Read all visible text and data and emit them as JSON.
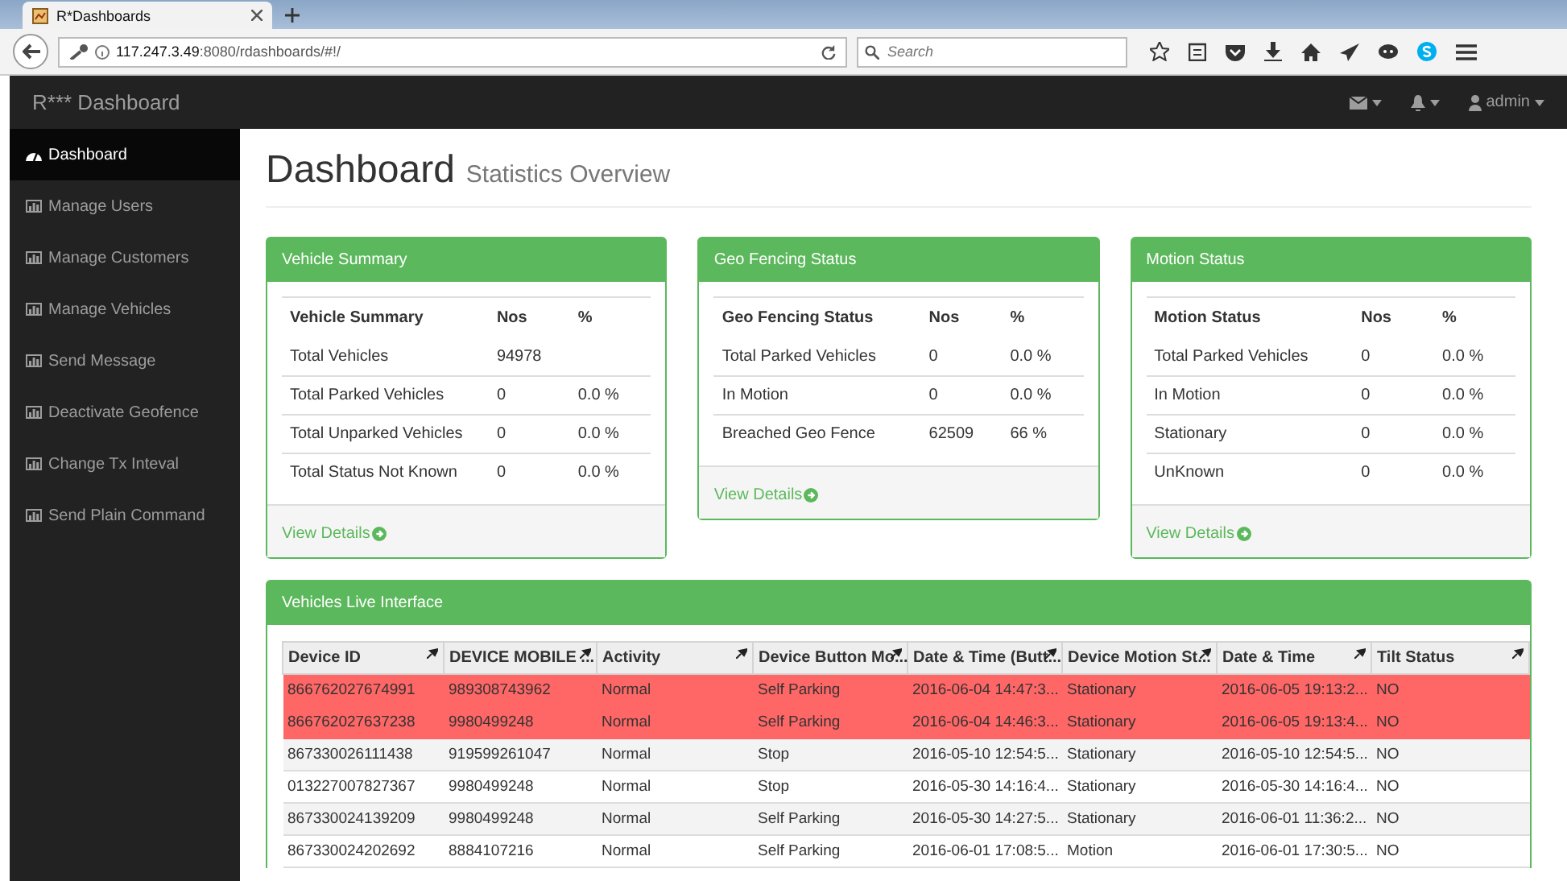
{
  "browser": {
    "tab_title": "R*Dashboards",
    "url_host": "117.247.3.49",
    "url_path": ":8080/rdashboards/#!/",
    "search_placeholder": "Search"
  },
  "navbar": {
    "brand": "R*** Dashboard",
    "user": "admin"
  },
  "sidebar": {
    "items": [
      {
        "label": "Dashboard",
        "kind": "dashboard",
        "selected": true
      },
      {
        "label": "Manage Users",
        "kind": "chart",
        "selected": false
      },
      {
        "label": "Manage Customers",
        "kind": "chart",
        "selected": false
      },
      {
        "label": "Manage Vehicles",
        "kind": "chart",
        "selected": false
      },
      {
        "label": "Send Message",
        "kind": "chart",
        "selected": false
      },
      {
        "label": "Deactivate Geofence",
        "kind": "chart",
        "selected": false
      },
      {
        "label": "Change Tx Inteval",
        "kind": "chart",
        "selected": false
      },
      {
        "label": "Send Plain Command",
        "kind": "chart",
        "selected": false
      }
    ]
  },
  "page": {
    "title": "Dashboard",
    "subtitle": "Statistics Overview"
  },
  "panels": [
    {
      "title": "Vehicle Summary",
      "columns": [
        "Vehicle Summary",
        "Nos",
        "%"
      ],
      "rows": [
        [
          "Total Vehicles",
          "94978",
          ""
        ],
        [
          "Total Parked Vehicles",
          "0",
          "0.0 %"
        ],
        [
          "Total Unparked Vehicles",
          "0",
          "0.0 %"
        ],
        [
          "Total Status Not Known",
          "0",
          "0.0 %"
        ]
      ],
      "link": "View Details"
    },
    {
      "title": "Geo Fencing Status",
      "columns": [
        "Geo Fencing Status",
        "Nos",
        "%"
      ],
      "rows": [
        [
          "Total Parked Vehicles",
          "0",
          "0.0 %"
        ],
        [
          "In Motion",
          "0",
          "0.0 %"
        ],
        [
          "Breached Geo Fence",
          "62509",
          "66 %"
        ]
      ],
      "link": "View Details"
    },
    {
      "title": "Motion Status",
      "columns": [
        "Motion Status",
        "Nos",
        "%"
      ],
      "rows": [
        [
          "Total Parked Vehicles",
          "0",
          "0.0 %"
        ],
        [
          "In Motion",
          "0",
          "0.0 %"
        ],
        [
          "Stationary",
          "0",
          "0.0 %"
        ],
        [
          "UnKnown",
          "0",
          "0.0 %"
        ]
      ],
      "link": "View Details"
    }
  ],
  "live": {
    "title": "Vehicles Live Interface",
    "columns": [
      "Device ID",
      "DEVICE MOBILE ...",
      "Activity",
      "Device Button Mo...",
      "Date & Time (Butt...",
      "Device Motion St...",
      "Date & Time",
      "Tilt Status"
    ],
    "rows": [
      {
        "alert": true,
        "cells": [
          "866762027674991",
          "989308743962",
          "Normal",
          "Self Parking",
          "2016-06-04 14:47:3...",
          "Stationary",
          "2016-06-05 19:13:2...",
          "NO"
        ]
      },
      {
        "alert": true,
        "cells": [
          "866762027637238",
          "9980499248",
          "Normal",
          "Self Parking",
          "2016-06-04 14:46:3...",
          "Stationary",
          "2016-06-05 19:13:4...",
          "NO"
        ]
      },
      {
        "alert": false,
        "cells": [
          "867330026111438",
          "919599261047",
          "Normal",
          "Stop",
          "2016-05-10 12:54:5...",
          "Stationary",
          "2016-05-10 12:54:5...",
          "NO"
        ]
      },
      {
        "alert": false,
        "cells": [
          "013227007827367",
          "9980499248",
          "Normal",
          "Stop",
          "2016-05-30 14:16:4...",
          "Stationary",
          "2016-05-30 14:16:4...",
          "NO"
        ]
      },
      {
        "alert": false,
        "cells": [
          "867330024139209",
          "9980499248",
          "Normal",
          "Self Parking",
          "2016-05-30 14:27:5...",
          "Stationary",
          "2016-06-01 11:36:2...",
          "NO"
        ]
      },
      {
        "alert": false,
        "cells": [
          "867330024202692",
          "8884107216",
          "Normal",
          "Self Parking",
          "2016-06-01 17:08:5...",
          "Motion",
          "2016-06-01 17:30:5...",
          "NO"
        ]
      }
    ]
  }
}
